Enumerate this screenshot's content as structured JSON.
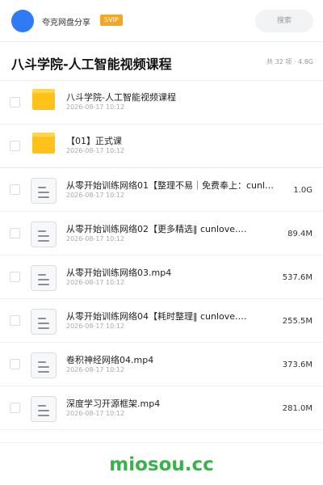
{
  "header": {
    "share_name": "夸克网盘分享",
    "badge": "SVIP",
    "search_placeholder": "搜索"
  },
  "folder": {
    "title": "八斗学院-人工智能视频课程",
    "meta": "共 32 项 · 4.8G"
  },
  "items": [
    {
      "type": "folder",
      "name": "八斗学院-人工智能视频课程",
      "date": "2026-08-17 10:12",
      "size": ""
    },
    {
      "type": "folder",
      "name": "【01】正式课",
      "date": "2026-08-17 10:12",
      "size": ""
    },
    {
      "type": "file",
      "name": "从零开始训练网络01【整理不易｜免费奉上：cunl…",
      "date": "2026-08-17 10:12",
      "size": "1.0G"
    },
    {
      "type": "file",
      "name": "从零开始训练网络02【更多精选‖ cunlove.…",
      "date": "2026-08-17 10:12",
      "size": "89.4M"
    },
    {
      "type": "file",
      "name": "从零开始训练网络03.mp4",
      "date": "2026-08-17 10:12",
      "size": "537.6M"
    },
    {
      "type": "file",
      "name": "从零开始训练网络04【耗时整理‖ cunlove.…",
      "date": "2026-08-17 10:12",
      "size": "255.5M"
    },
    {
      "type": "file",
      "name": "卷积神经网络04.mp4",
      "date": "2026-08-17 10:12",
      "size": "373.6M"
    },
    {
      "type": "file",
      "name": "深度学习开源框架.mp4",
      "date": "2026-08-17 10:12",
      "size": "281.0M"
    }
  ],
  "watermark": "miosou.cc",
  "colors": {
    "accent": "#2f7bf6",
    "svip": "#f5a623",
    "folder": "#ffc21a",
    "watermark": "#38b24a"
  }
}
